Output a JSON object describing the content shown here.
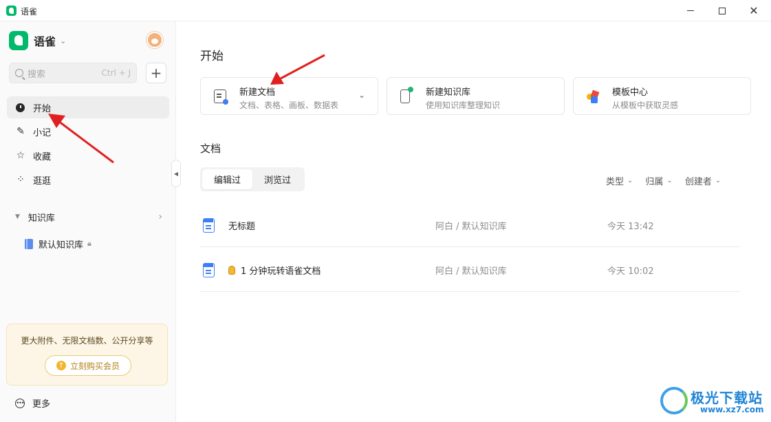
{
  "window": {
    "title": "语雀",
    "minimize_icon": "minimize-icon",
    "maximize_icon": "maximize-icon",
    "close_icon": "close-icon"
  },
  "sidebar": {
    "brand": "语雀",
    "search": {
      "placeholder": "搜索",
      "shortcut": "Ctrl + J"
    },
    "add_label": "+",
    "nav": [
      {
        "label": "开始",
        "icon": "clock-icon",
        "active": true
      },
      {
        "label": "小记",
        "icon": "feather-icon",
        "active": false
      },
      {
        "label": "收藏",
        "icon": "star-icon",
        "active": false
      },
      {
        "label": "逛逛",
        "icon": "grid-icon",
        "active": false
      }
    ],
    "knowledge_base": {
      "title": "知识库",
      "items": [
        {
          "label": "默认知识库",
          "locked": true
        }
      ]
    },
    "promo": {
      "text": "更大附件、无限文档数、公开分享等",
      "button": "立刻购买会员"
    },
    "more": "更多"
  },
  "main": {
    "start_title": "开始",
    "cards": [
      {
        "title": "新建文档",
        "subtitle": "文档、表格、画板、数据表",
        "icon": "new-doc-icon",
        "has_dropdown": true
      },
      {
        "title": "新建知识库",
        "subtitle": "使用知识库整理知识",
        "icon": "new-kb-icon",
        "has_dropdown": false
      },
      {
        "title": "模板中心",
        "subtitle": "从模板中获取灵感",
        "icon": "template-icon",
        "has_dropdown": false
      }
    ],
    "docs_title": "文档",
    "tabs": [
      {
        "label": "编辑过",
        "active": true
      },
      {
        "label": "浏览过",
        "active": false
      }
    ],
    "filters": [
      "类型",
      "归属",
      "创建者"
    ],
    "documents": [
      {
        "title": "无标题",
        "path": "阿白 / 默认知识库",
        "time": "今天 13:42",
        "has_bulb": false
      },
      {
        "title": "1 分钟玩转语雀文档",
        "path": "阿白 / 默认知识库",
        "time": "今天 10:02",
        "has_bulb": true
      }
    ]
  },
  "watermark": {
    "name": "极光下载站",
    "url": "www.xz7.com"
  },
  "colors": {
    "brand": "#00b96b",
    "doc_blue": "#3d7ef6",
    "annotation": "#e02020"
  }
}
